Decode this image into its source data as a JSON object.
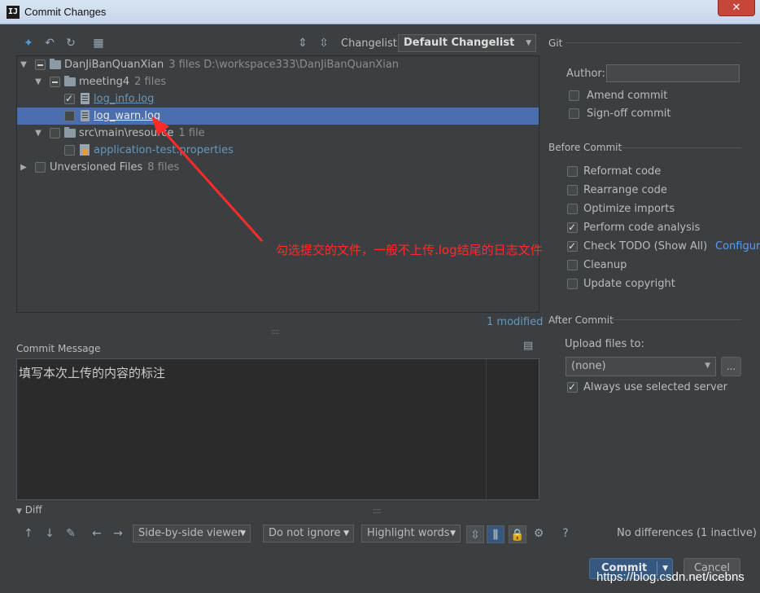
{
  "window": {
    "title": "Commit Changes",
    "close_label": "✕"
  },
  "toolbar": {
    "changelist_label": "Changelist:",
    "changelist_value": "Default Changelist"
  },
  "tree": {
    "root": {
      "name": "DanJiBanQuanXian",
      "meta": "3 files  D:\\workspace333\\DanJiBanQuanXian"
    },
    "meeting": {
      "name": "meeting4",
      "meta": "2 files"
    },
    "file1": "log_info.log",
    "file2": "log_warn.log",
    "src": {
      "name": "src\\main\\resource",
      "meta": "1 file"
    },
    "file3": "application-test.properties",
    "unversioned": {
      "name": "Unversioned Files",
      "meta": "8 files"
    }
  },
  "modified_count": "1 modified",
  "annotation": "勾选提交的文件，一般不上传.log结尾的日志文件",
  "commit_message": {
    "label": "Commit Message",
    "text": "填写本次上传的内容的标注"
  },
  "git": {
    "section": "Git",
    "author_label": "Author:",
    "author_value": "",
    "amend": "Amend commit",
    "signoff": "Sign-off commit"
  },
  "before_commit": {
    "section": "Before Commit",
    "options": [
      {
        "label": "Reformat code",
        "checked": false
      },
      {
        "label": "Rearrange code",
        "checked": false
      },
      {
        "label": "Optimize imports",
        "checked": false
      },
      {
        "label": "Perform code analysis",
        "checked": true
      },
      {
        "label": "Check TODO (Show All)",
        "checked": true,
        "link": "Configure"
      },
      {
        "label": "Cleanup",
        "checked": false
      },
      {
        "label": "Update copyright",
        "checked": false
      }
    ]
  },
  "after_commit": {
    "section": "After Commit",
    "upload_label": "Upload files to:",
    "upload_value": "(none)",
    "browse_label": "...",
    "always_use": "Always use selected server"
  },
  "diff": {
    "label": "Diff",
    "viewer": "Side-by-side viewer",
    "ignore": "Do not ignore",
    "highlight": "Highlight words",
    "help": "?",
    "status": "No differences (1 inactive)"
  },
  "buttons": {
    "commit": "Commit",
    "cancel": "Cancel"
  },
  "watermark": "https://blog.csdn.net/icebns",
  "colors": {
    "accent": "#4b6eaf",
    "annotation": "#ff2a2a",
    "link": "#589df6"
  }
}
